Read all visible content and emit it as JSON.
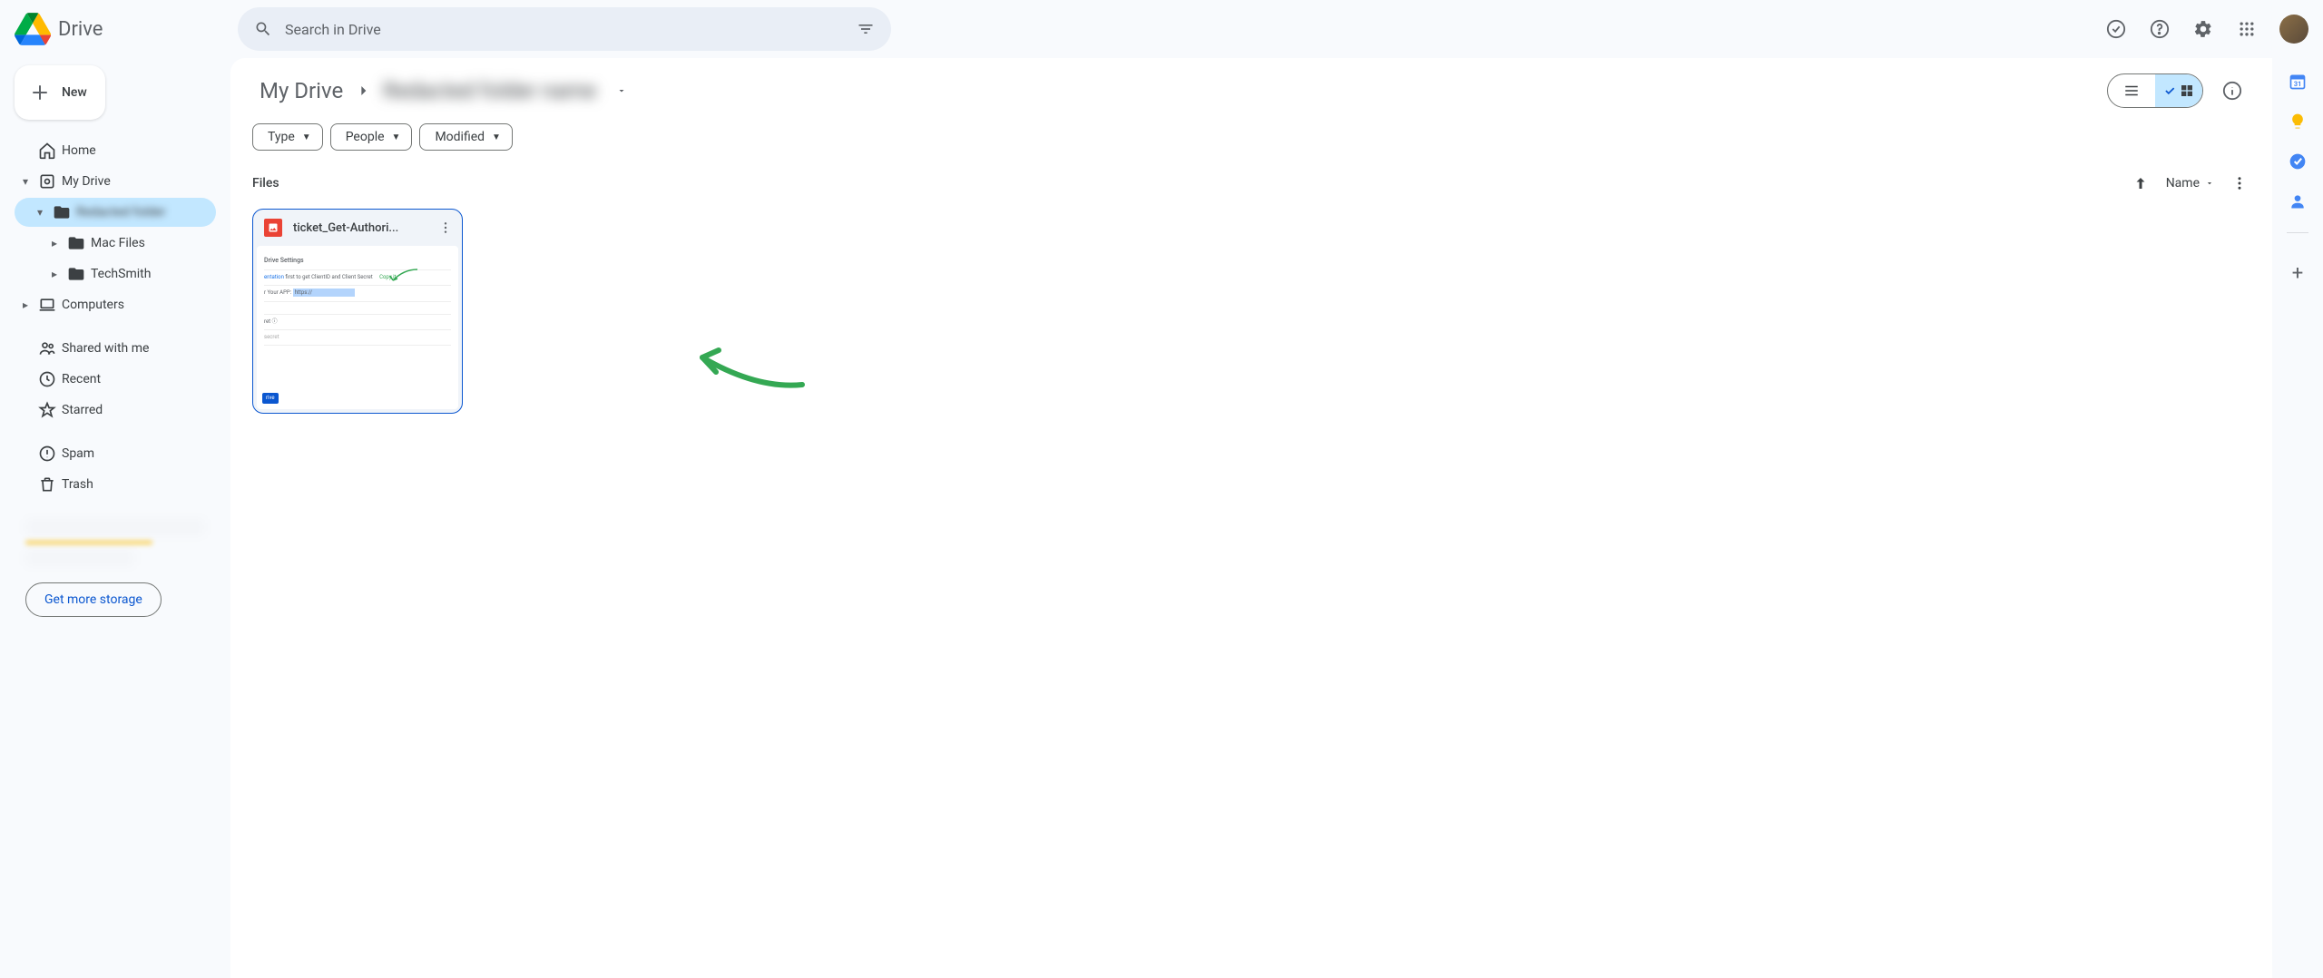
{
  "app": {
    "name": "Drive"
  },
  "search": {
    "placeholder": "Search in Drive"
  },
  "header_icons": [
    "offline",
    "help",
    "settings",
    "apps"
  ],
  "new_button": {
    "label": "New"
  },
  "sidebar": {
    "items": [
      {
        "id": "home",
        "label": "Home",
        "icon": "home",
        "expandable": false,
        "level": 0
      },
      {
        "id": "mydrive",
        "label": "My Drive",
        "icon": "drive-box",
        "expandable": true,
        "expanded": true,
        "level": 0
      },
      {
        "id": "folder-current",
        "label": "Redacted folder",
        "icon": "folder",
        "expandable": true,
        "expanded": true,
        "level": 1,
        "selected": true,
        "blurred": true
      },
      {
        "id": "mac-files",
        "label": "Mac Files",
        "icon": "folder",
        "expandable": true,
        "level": 2
      },
      {
        "id": "techsmith",
        "label": "TechSmith",
        "icon": "folder",
        "expandable": true,
        "level": 2
      },
      {
        "id": "computers",
        "label": "Computers",
        "icon": "laptop",
        "expandable": true,
        "level": 0
      },
      {
        "id": "shared",
        "label": "Shared with me",
        "icon": "people",
        "level": 0,
        "gapTop": true
      },
      {
        "id": "recent",
        "label": "Recent",
        "icon": "clock",
        "level": 0
      },
      {
        "id": "starred",
        "label": "Starred",
        "icon": "star",
        "level": 0
      },
      {
        "id": "spam",
        "label": "Spam",
        "icon": "spam",
        "level": 0,
        "gapTop": true
      },
      {
        "id": "trash",
        "label": "Trash",
        "icon": "trash",
        "level": 0
      }
    ],
    "storage_button": "Get more storage"
  },
  "breadcrumb": {
    "root": "My Drive",
    "current": "Redacted folder name"
  },
  "filter_chips": [
    "Type",
    "People",
    "Modified"
  ],
  "section_title": "Files",
  "sort": {
    "label": "Name"
  },
  "files": [
    {
      "name": "ticket_Get-Authori...",
      "type": "image"
    }
  ],
  "colors": {
    "accent": "#0b57d0",
    "selected_bg": "#c2e7ff",
    "annotation_green": "#34a853"
  },
  "right_rail": [
    "calendar",
    "keep",
    "tasks",
    "contacts"
  ]
}
